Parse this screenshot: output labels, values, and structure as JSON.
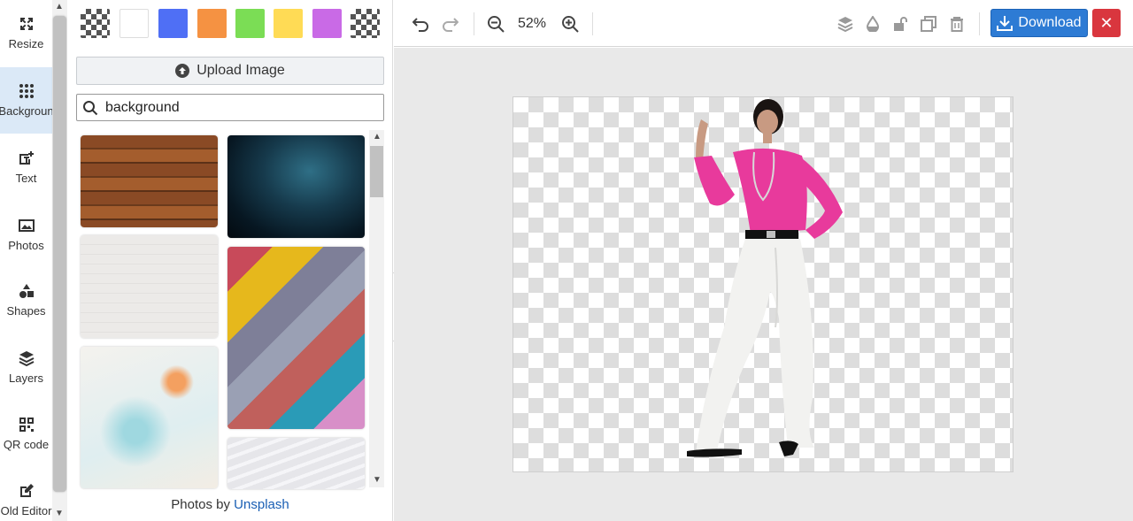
{
  "sidebar": {
    "items": [
      {
        "label": "Resize",
        "icon": "resize-icon"
      },
      {
        "label": "Backgroun",
        "icon": "dots-grid-icon"
      },
      {
        "label": "Text",
        "icon": "text-icon"
      },
      {
        "label": "Photos",
        "icon": "image-icon"
      },
      {
        "label": "Shapes",
        "icon": "shapes-icon"
      },
      {
        "label": "Layers",
        "icon": "layers-icon"
      },
      {
        "label": "QR code",
        "icon": "qr-code-icon"
      },
      {
        "label": "Old Editor",
        "icon": "edit-icon"
      }
    ],
    "active_index": 1
  },
  "panel": {
    "swatches": [
      "transparent",
      "#ffffff",
      "#4f6ff5",
      "#f59242",
      "#7bdd55",
      "#ffdb55",
      "#c96ae6",
      "transparent"
    ],
    "upload_label": "Upload Image",
    "search_value": "background",
    "credits_prefix": "Photos by",
    "credits_link": "Unsplash"
  },
  "toolbar": {
    "zoom": "52%",
    "download_label": "Download",
    "close_label": "✕"
  },
  "colors": {
    "accent": "#2d7bd4",
    "danger": "#d9363e",
    "active_bg": "#dbe9f7"
  }
}
